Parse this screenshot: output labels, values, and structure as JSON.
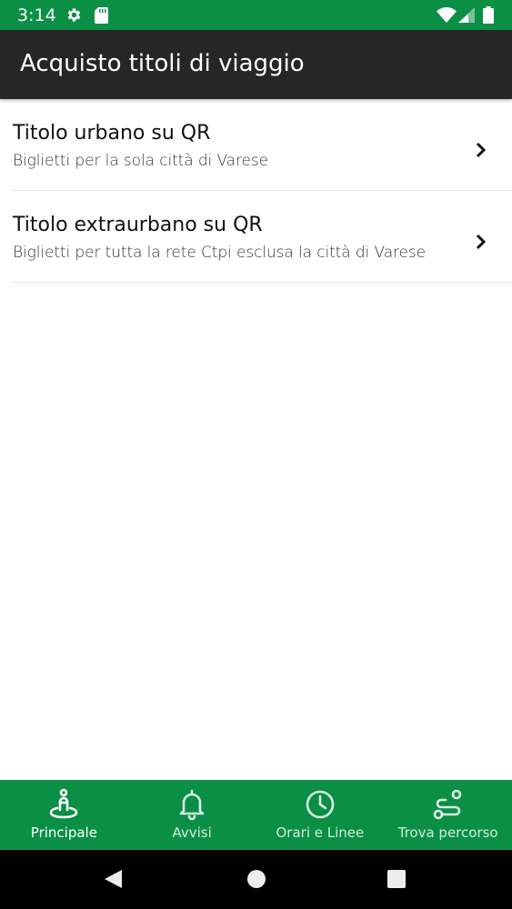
{
  "status_bar": {
    "time": "3:14",
    "left_icons": [
      "gear-icon",
      "sd-card-icon"
    ],
    "right_icons": [
      "wifi-icon",
      "signal-icon",
      "battery-icon"
    ]
  },
  "app_bar": {
    "title": "Acquisto titoli di viaggio"
  },
  "list": {
    "items": [
      {
        "title": "Titolo urbano su QR",
        "subtitle": "Biglietti per la sola città di Varese",
        "icon": "chevron-right-icon"
      },
      {
        "title": "Titolo extraurbano su QR",
        "subtitle": "Biglietti per tutta la rete Ctpi esclusa la città di Varese",
        "icon": "chevron-right-icon"
      }
    ]
  },
  "bottom_nav": {
    "items": [
      {
        "label": "Principale",
        "icon": "person-location-icon",
        "active": true
      },
      {
        "label": "Avvisi",
        "icon": "bell-icon",
        "active": false
      },
      {
        "label": "Orari e Linee",
        "icon": "clock-icon",
        "active": false
      },
      {
        "label": "Trova percorso",
        "icon": "route-icon",
        "active": false
      }
    ]
  },
  "system_nav": {
    "buttons": [
      "back-icon",
      "home-icon",
      "recents-icon"
    ]
  },
  "colors": {
    "status_bar": "#0a8f44",
    "app_bar": "#262626",
    "bottom_nav": "#0a8f44",
    "system_nav": "#000000"
  }
}
